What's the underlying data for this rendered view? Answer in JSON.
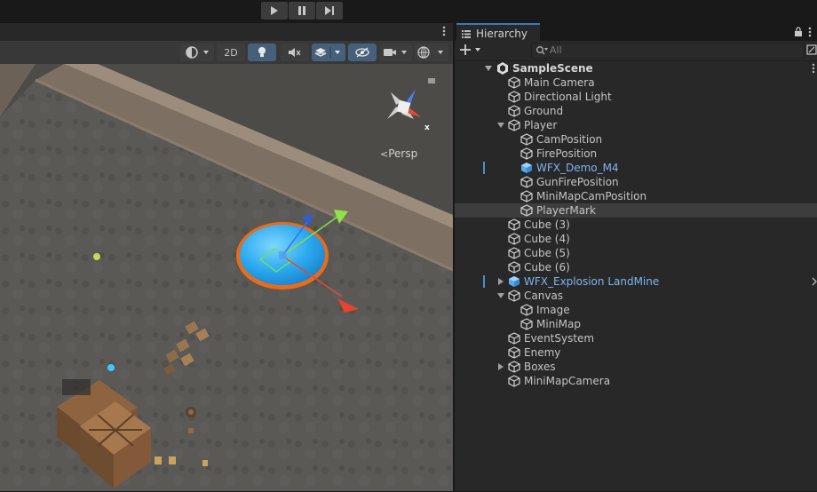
{
  "play_toolbar": {
    "buttons": [
      "play",
      "pause",
      "step"
    ]
  },
  "scene_view": {
    "toolbar": {
      "btn_2d": "2D",
      "icons": [
        "draw-mode-icon",
        "lighting-icon",
        "audio-icon",
        "effects-icon",
        "hidden-objects-icon",
        "camera-icon",
        "gizmos-icon"
      ]
    },
    "projection_label": "Persp",
    "gizmo_axis_label": "x",
    "accent_color": "#3fa9f5"
  },
  "hierarchy": {
    "tab_title": "Hierarchy",
    "search": {
      "placeholder": "All",
      "value": ""
    },
    "scene_name": "SampleScene",
    "items": [
      {
        "label": "Main Camera",
        "depth": 1,
        "expander": "none",
        "type": "object"
      },
      {
        "label": "Directional Light",
        "depth": 1,
        "expander": "none",
        "type": "object"
      },
      {
        "label": "Ground",
        "depth": 1,
        "expander": "none",
        "type": "object"
      },
      {
        "label": "Player",
        "depth": 1,
        "expander": "expanded",
        "type": "object"
      },
      {
        "label": "CamPosition",
        "depth": 2,
        "expander": "none",
        "type": "object"
      },
      {
        "label": "FirePosition",
        "depth": 2,
        "expander": "none",
        "type": "object"
      },
      {
        "label": "WFX_Demo_M4",
        "depth": 2,
        "expander": "none",
        "type": "prefab"
      },
      {
        "label": "GunFirePosition",
        "depth": 2,
        "expander": "none",
        "type": "object"
      },
      {
        "label": "MiniMapCamPosition",
        "depth": 2,
        "expander": "none",
        "type": "object"
      },
      {
        "label": "PlayerMark",
        "depth": 2,
        "expander": "none",
        "type": "object",
        "selected": true
      },
      {
        "label": "Cube (3)",
        "depth": 1,
        "expander": "none",
        "type": "object"
      },
      {
        "label": "Cube (4)",
        "depth": 1,
        "expander": "none",
        "type": "object"
      },
      {
        "label": "Cube (5)",
        "depth": 1,
        "expander": "none",
        "type": "object"
      },
      {
        "label": "Cube (6)",
        "depth": 1,
        "expander": "none",
        "type": "object"
      },
      {
        "label": "WFX_Explosion LandMine",
        "depth": 1,
        "expander": "collapsed",
        "type": "prefab"
      },
      {
        "label": "Canvas",
        "depth": 1,
        "expander": "expanded",
        "type": "object"
      },
      {
        "label": "Image",
        "depth": 2,
        "expander": "none",
        "type": "object"
      },
      {
        "label": "MiniMap",
        "depth": 2,
        "expander": "none",
        "type": "object"
      },
      {
        "label": "EventSystem",
        "depth": 1,
        "expander": "none",
        "type": "object"
      },
      {
        "label": "Enemy",
        "depth": 1,
        "expander": "none",
        "type": "object"
      },
      {
        "label": "Boxes",
        "depth": 1,
        "expander": "collapsed",
        "type": "object"
      },
      {
        "label": "MiniMapCamera",
        "depth": 1,
        "expander": "none",
        "type": "object"
      }
    ]
  }
}
